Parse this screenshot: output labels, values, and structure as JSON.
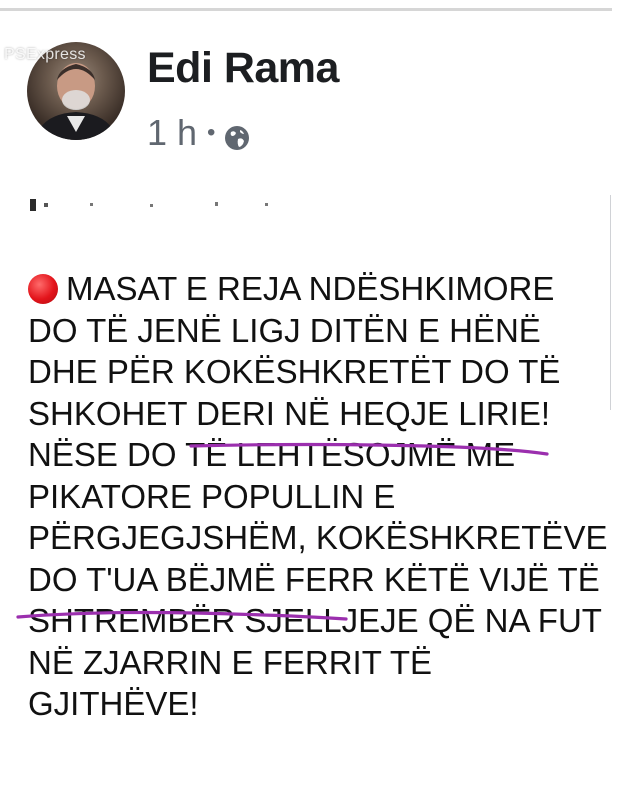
{
  "watermark": "PSExpress",
  "author": {
    "name": "Edi Rama",
    "time": "1 h",
    "separator": "•",
    "audience_icon": "globe-icon"
  },
  "post": {
    "lead_icon": "red-circle-icon",
    "line1": "MASAT E REJA NDËSHKIMORE",
    "line2": "DO TË JENË LIGJ DITËN E HËNË",
    "line3": "DHE PËR KOKËSHKRETËT DO TË",
    "line4": "SHKOHET DERI NË HEQJE LIRIE!",
    "line5": "NËSE DO TË LEHTËSOJMË ME",
    "line6": "PIKATORE POPULLIN E",
    "line7": "PËRGJEGJSHËM, KOKËSHKRETËVE",
    "line8": "DO T'UA BËJMË FERR KËTË VIJË TË",
    "line9": "SHTREMBËR SJELLJEJE QË NA FUT",
    "line10": "NË ZJARRIN E FERRIT TË",
    "line11": "GJITHËVE!"
  },
  "colors": {
    "underline": "#9b2fae",
    "lead_icon": "#e3141b",
    "meta": "#606770"
  }
}
